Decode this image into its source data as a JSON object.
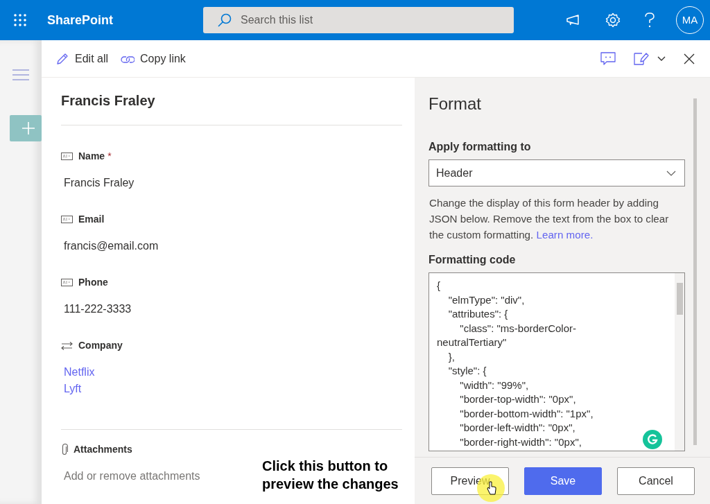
{
  "app_bar": {
    "app_name": "SharePoint",
    "search": {
      "placeholder": "Search this list"
    },
    "avatar": "MA"
  },
  "panel_toolbar": {
    "actions": [
      {
        "label": "Edit all",
        "kind": "edit"
      },
      {
        "label": "Copy link",
        "kind": "link"
      }
    ]
  },
  "form": {
    "title": "Francis Fraley",
    "required_mark": "*",
    "fields": [
      {
        "kind": "text",
        "label": "Name",
        "required": true,
        "values": [
          "Francis Fraley"
        ]
      },
      {
        "kind": "text",
        "label": "Email",
        "required": false,
        "values": [
          "francis@email.com"
        ]
      },
      {
        "kind": "text",
        "label": "Phone",
        "required": false,
        "values": [
          "111-222-3333"
        ]
      },
      {
        "kind": "lookup",
        "label": "Company",
        "required": false,
        "values": [
          "Netflix",
          "Lyft"
        ]
      }
    ],
    "attachments": {
      "label": "Attachments",
      "action": "Add or remove attachments"
    }
  },
  "format_pane": {
    "title": "Format",
    "apply_label": "Apply formatting to",
    "apply_value": "Header",
    "description": "Change the display of this form header by adding JSON below. Remove the text from the box to clear the custom formatting.",
    "learn_more": "Learn more.",
    "code_label": "Formatting code",
    "code_lines": [
      "{",
      "    \"elmType\": \"div\",",
      "    \"attributes\": {",
      "        \"class\": \"ms-borderColor-",
      "neutralTertiary\"",
      "    },",
      "    \"style\": {",
      "        \"width\": \"99%\",",
      "        \"border-top-width\": \"0px\",",
      "        \"border-bottom-width\": \"1px\",",
      "        \"border-left-width\": \"0px\",",
      "        \"border-right-width\": \"0px\","
    ],
    "buttons": [
      {
        "label": "Preview",
        "kind": "default"
      },
      {
        "label": "Save",
        "kind": "primary"
      },
      {
        "label": "Cancel",
        "kind": "default"
      }
    ]
  },
  "annotation": {
    "text": "Click this button to preview the changes"
  }
}
